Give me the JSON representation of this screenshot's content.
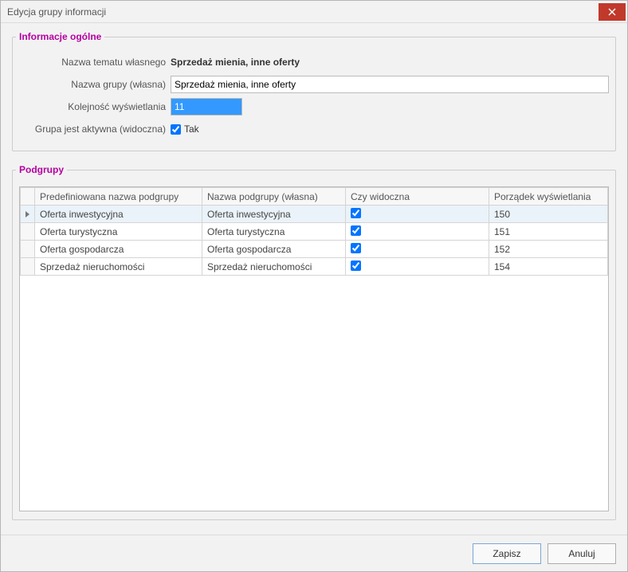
{
  "titlebar": {
    "title": "Edycja grupy informacji"
  },
  "general": {
    "legend": "Informacje ogólne",
    "labels": {
      "topic": "Nazwa tematu własnego",
      "group": "Nazwa grupy (własna)",
      "order": "Kolejność wyświetlania",
      "active": "Grupa jest aktywna (widoczna)"
    },
    "values": {
      "topic": "Sprzedaż mienia, inne oferty",
      "group": "Sprzedaż mienia, inne oferty",
      "order": "11",
      "active_checked": true,
      "active_label": "Tak"
    }
  },
  "subgroups": {
    "legend": "Podgrupy",
    "headers": {
      "predef": "Predefiniowana nazwa podgrupy",
      "own": "Nazwa podgrupy (własna)",
      "visible": "Czy widoczna",
      "order": "Porządek wyświetlania"
    },
    "rows": [
      {
        "predef": "Oferta inwestycyjna",
        "own": "Oferta inwestycyjna",
        "visible": true,
        "order": "150",
        "active": true
      },
      {
        "predef": "Oferta turystyczna",
        "own": "Oferta turystyczna",
        "visible": true,
        "order": "151",
        "active": false
      },
      {
        "predef": "Oferta gospodarcza",
        "own": "Oferta gospodarcza",
        "visible": true,
        "order": "152",
        "active": false
      },
      {
        "predef": "Sprzedaż nieruchomości",
        "own": "Sprzedaż nieruchomości",
        "visible": true,
        "order": "154",
        "active": false
      }
    ]
  },
  "footer": {
    "save": "Zapisz",
    "cancel": "Anuluj"
  }
}
